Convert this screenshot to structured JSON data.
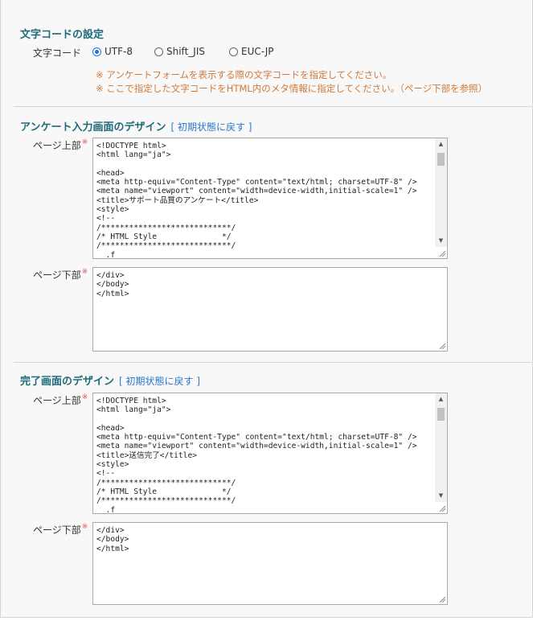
{
  "charset": {
    "title": "文字コードの設定",
    "label": "文字コード",
    "options": [
      "UTF-8",
      "Shift_JIS",
      "EUC-JP"
    ],
    "selected": "UTF-8",
    "notes": [
      "※ アンケートフォームを表示する際の文字コードを指定してください。",
      "※ ここで指定した文字コードをHTML内のメタ情報に指定してください。（ページ下部を参照）"
    ]
  },
  "survey_design": {
    "title": "アンケート入力画面のデザイン",
    "reset_label": "[ 初期状態に戻す ]",
    "top_label": "ページ上部",
    "bottom_label": "ページ下部",
    "required_mark": "※",
    "top_code": "<!DOCTYPE html>\n<html lang=\"ja\">\n\n<head>\n<meta http-equiv=\"Content-Type\" content=\"text/html; charset=UTF-8\" />\n<meta name=\"viewport\" content=\"width=device-width,initial-scale=1\" />\n<title>サポート品質のアンケート</title>\n<style>\n<!--\n/****************************/\n/* HTML Style              */\n/****************************/\n  .f",
    "bottom_code": "</div>\n</body>\n</html>"
  },
  "complete_design": {
    "title": "完了画面のデザイン",
    "reset_label": "[ 初期状態に戻す ]",
    "top_label": "ページ上部",
    "bottom_label": "ページ下部",
    "required_mark": "※",
    "top_code": "<!DOCTYPE html>\n<html lang=\"ja\">\n\n<head>\n<meta http-equiv=\"Content-Type\" content=\"text/html; charset=UTF-8\" />\n<meta name=\"viewport\" content=\"width=device-width,initial-scale=1\" />\n<title>送信完了</title>\n<style>\n<!--\n/****************************/\n/* HTML Style              */\n/****************************/\n  .f",
    "bottom_code": "</div>\n</body>\n</html>"
  },
  "colors": {
    "section_title": "#1d6a7a",
    "link": "#2a78c9",
    "note": "#d07a3a",
    "required": "#e05050",
    "radio_selected": "#1a73d9"
  }
}
